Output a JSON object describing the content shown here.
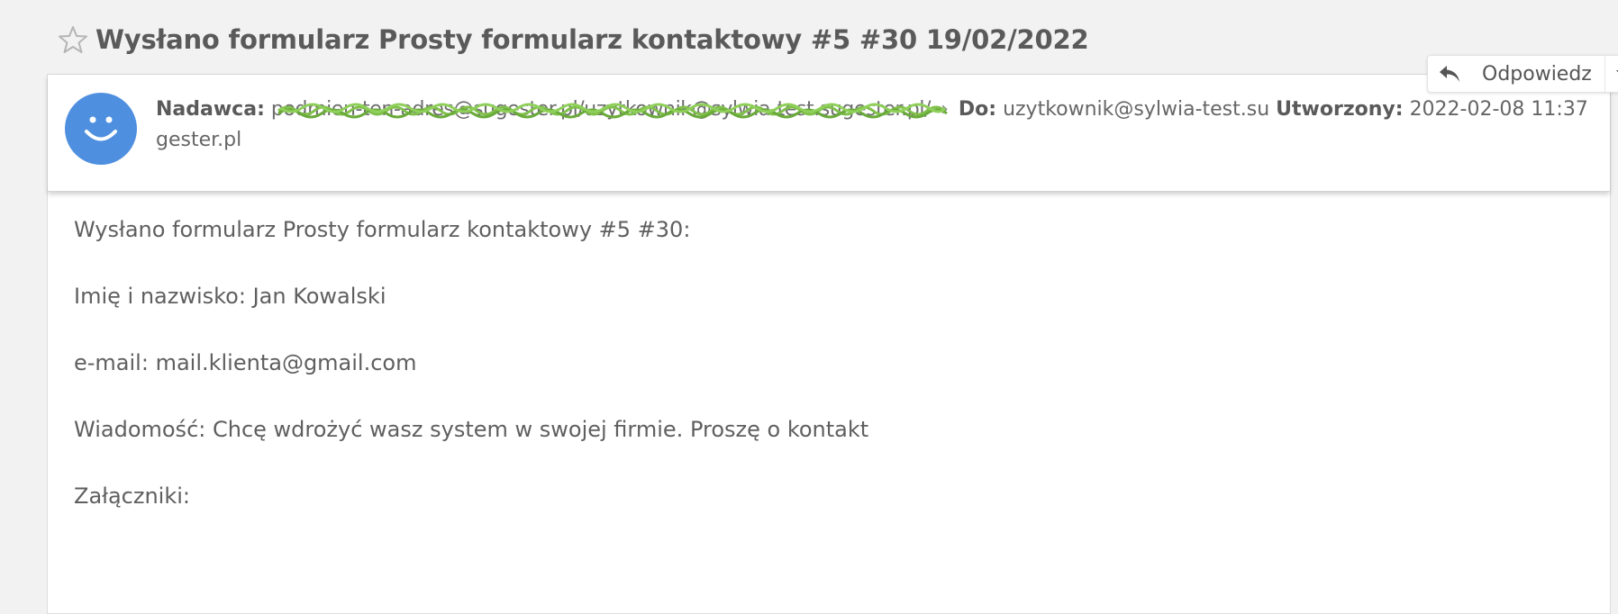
{
  "subject": {
    "title": "Wysłano formularz Prosty formularz kontaktowy #5 #30 19/02/2022",
    "star_icon": "star-outline-icon"
  },
  "header": {
    "sender_label": "Nadawca:",
    "sender_email_line1": "podmien-ten-adres@sugester.pl/uzytkownik@sylwia-test.sugester.pl/",
    "sender_email_line2": "gester.pl",
    "separator_icon": "chevron-right-icon",
    "to_label": "Do:",
    "to_value": "uzytkownik@sylwia-test.su",
    "created_label": "Utworzony:",
    "created_value": "2022-02-08 11:37",
    "avatar_icon": "smiley-avatar-icon",
    "redaction_color": "#7fc04a"
  },
  "reply": {
    "label": "Odpowiedz",
    "icon": "reply-arrow-icon",
    "dropdown_icon": "caret-down-icon"
  },
  "body": {
    "lines": [
      "Wysłano formularz Prosty formularz kontaktowy #5 #30:",
      "Imię i nazwisko: Jan Kowalski",
      "e-mail: mail.klienta@gmail.com",
      "Wiadomość: Chcę wdrożyć wasz system w swojej firmie. Proszę o kontakt",
      "Załączniki:"
    ]
  },
  "colors": {
    "background": "#f2f2f2",
    "avatar": "#4f8fdf",
    "text": "#5f5f5f"
  }
}
